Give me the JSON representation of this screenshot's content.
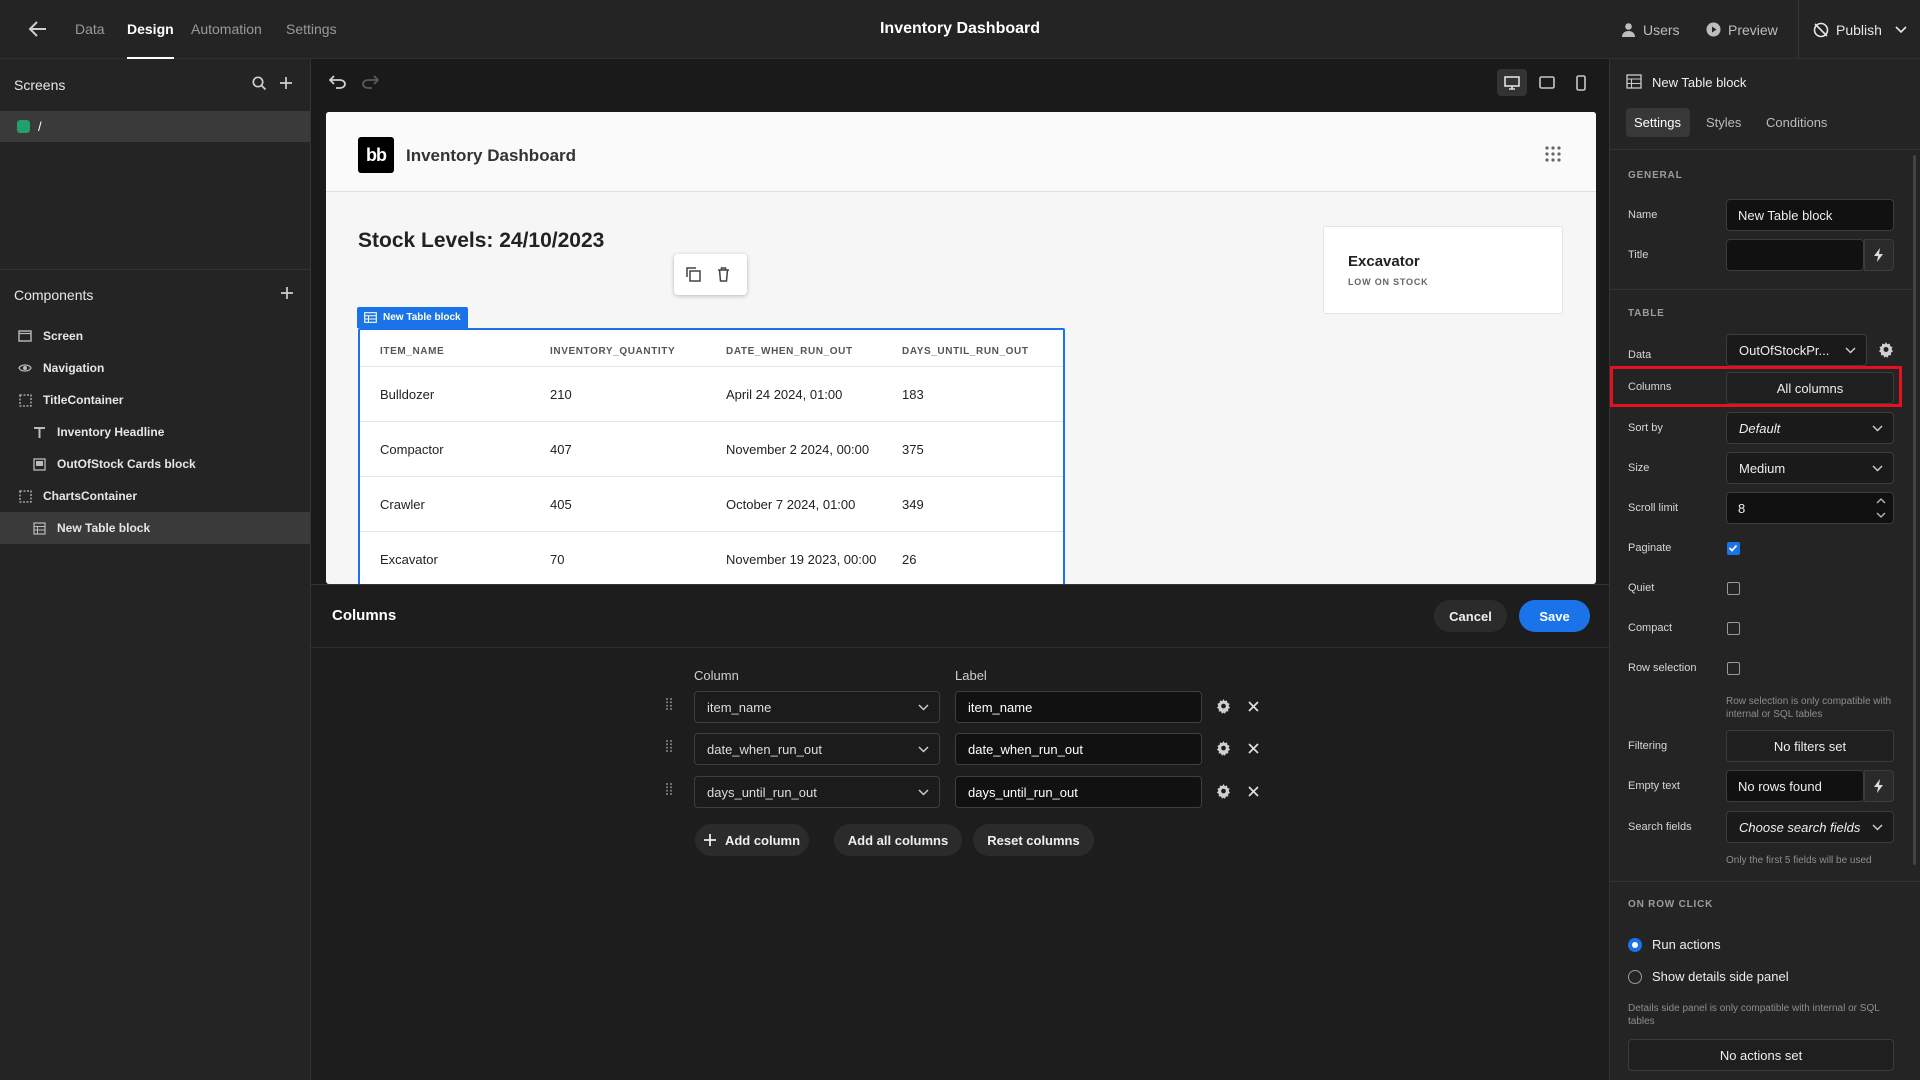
{
  "topbar": {
    "tabs": [
      "Data",
      "Design",
      "Automation",
      "Settings"
    ],
    "active_tab": "Design",
    "title": "Inventory Dashboard",
    "users_label": "Users",
    "preview_label": "Preview",
    "publish_label": "Publish"
  },
  "left": {
    "screens_title": "Screens",
    "screen_route": "/",
    "components_title": "Components",
    "components": [
      {
        "label": "Screen",
        "icon": "screen-icon"
      },
      {
        "label": "Navigation",
        "icon": "eye-icon"
      },
      {
        "label": "TitleContainer",
        "icon": "container-icon"
      },
      {
        "label": "Inventory Headline",
        "icon": "text-icon"
      },
      {
        "label": "OutOfStock Cards block",
        "icon": "cards-icon"
      },
      {
        "label": "ChartsContainer",
        "icon": "container-icon"
      },
      {
        "label": "New Table block",
        "icon": "table-icon"
      }
    ]
  },
  "canvas": {
    "app_logo": "bb",
    "app_title": "Inventory Dashboard",
    "headline": "Stock Levels: 24/10/2023",
    "card_title": "Excavator",
    "card_subtitle": "LOW ON STOCK",
    "block_tag": "New Table block",
    "table": {
      "headers": [
        "ITEM_NAME",
        "INVENTORY_QUANTITY",
        "DATE_WHEN_RUN_OUT",
        "DAYS_UNTIL_RUN_OUT"
      ],
      "rows": [
        [
          "Bulldozer",
          "210",
          "April 24 2024, 01:00",
          "183"
        ],
        [
          "Compactor",
          "407",
          "November 2 2024, 00:00",
          "375"
        ],
        [
          "Crawler",
          "405",
          "October 7 2024, 01:00",
          "349"
        ],
        [
          "Excavator",
          "70",
          "November 19 2023, 00:00",
          "26"
        ]
      ]
    }
  },
  "columns_modal": {
    "title": "Columns",
    "cancel_label": "Cancel",
    "save_label": "Save",
    "column_header": "Column",
    "label_header": "Label",
    "rows": [
      {
        "column": "item_name",
        "label": "item_name"
      },
      {
        "column": "date_when_run_out",
        "label": "date_when_run_out"
      },
      {
        "column": "days_until_run_out",
        "label": "days_until_run_out"
      }
    ],
    "add_column_label": "Add column",
    "add_all_label": "Add all columns",
    "reset_label": "Reset columns"
  },
  "right": {
    "block_name": "New Table block",
    "tabs": [
      "Settings",
      "Styles",
      "Conditions"
    ],
    "active_tab": "Settings",
    "general_heading": "GENERAL",
    "name_label": "Name",
    "name_value": "New Table block",
    "title_label": "Title",
    "title_value": "",
    "table_heading": "TABLE",
    "data_label": "Data",
    "data_value": "OutOfStockPr...",
    "columns_label": "Columns",
    "columns_value": "All columns",
    "sortby_label": "Sort by",
    "sortby_value": "Default",
    "size_label": "Size",
    "size_value": "Medium",
    "scroll_label": "Scroll limit",
    "scroll_value": "8",
    "paginate_label": "Paginate",
    "paginate_checked": true,
    "quiet_label": "Quiet",
    "quiet_checked": false,
    "compact_label": "Compact",
    "compact_checked": false,
    "rowsel_label": "Row selection",
    "rowsel_checked": false,
    "rowsel_hint": "Row selection is only compatible with internal or SQL tables",
    "filtering_label": "Filtering",
    "filtering_value": "No filters set",
    "empty_label": "Empty text",
    "empty_value": "No rows found",
    "search_label": "Search fields",
    "search_value": "Choose search fields",
    "search_hint": "Only the first 5 fields will be used",
    "onrow_heading": "ON ROW CLICK",
    "radio_run": "Run actions",
    "radio_panel": "Show details side panel",
    "panel_hint": "Details side panel is only compatible with internal or SQL tables",
    "actions_value": "No actions set"
  },
  "colors": {
    "accent": "#1a73e8",
    "highlight": "#e8101f"
  }
}
